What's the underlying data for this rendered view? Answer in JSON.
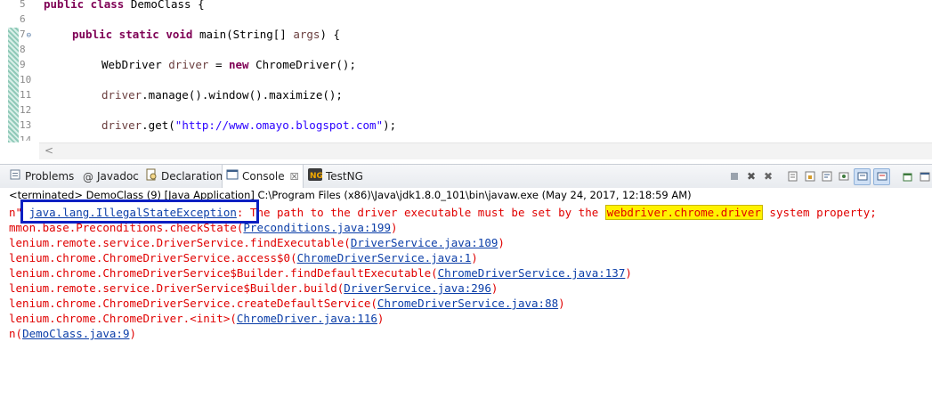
{
  "editor": {
    "lines": [
      {
        "n": "5",
        "fold": "",
        "code": [
          {
            "t": "public class ",
            "s": "kw"
          },
          {
            "t": "DemoClass {",
            "s": ""
          }
        ],
        "top": 0
      },
      {
        "n": "6",
        "fold": "",
        "code": [],
        "top": 0
      },
      {
        "n": "7",
        "fold": "⊖",
        "code": [],
        "top": 0
      },
      {
        "n": "8",
        "fold": "",
        "code": [],
        "top": 0
      },
      {
        "n": "9",
        "fold": "",
        "code": [],
        "top": 0
      },
      {
        "n": "10",
        "fold": "",
        "code": [],
        "top": 0
      },
      {
        "n": "11",
        "fold": "",
        "code": [],
        "top": 0
      },
      {
        "n": "12",
        "fold": "",
        "code": [],
        "top": 0
      },
      {
        "n": "13",
        "fold": "",
        "code": [],
        "top": 0
      },
      {
        "n": "14",
        "fold": "",
        "code": [],
        "top": 0
      }
    ],
    "code_line_5_a": "public class",
    "code_line_5_b": " DemoClass {",
    "code_line_7_a": "public static void",
    "code_line_7_b": " main(String[] ",
    "code_line_7_c": "args",
    "code_line_7_d": ") {",
    "code_line_9_a": "WebDriver ",
    "code_line_9_b": "driver",
    "code_line_9_c": " = ",
    "code_line_9_d": "new",
    "code_line_9_e": " ChromeDriver();",
    "code_line_11_a": "driver",
    "code_line_11_b": ".manage().window().maximize();",
    "code_line_13_a": "driver",
    "code_line_13_b": ".get(",
    "code_line_13_c": "\"http://www.omayo.blogspot.com\"",
    "code_line_13_d": ");",
    "scroll_left": "<"
  },
  "tabs": {
    "problems": "Problems",
    "javadoc": "Javadoc",
    "declaration": "Declaration",
    "console": "Console",
    "console_close": "☒",
    "testng": "TestNG"
  },
  "console": {
    "terminated": "<terminated> DemoClass (9) [Java Application] C:\\Program Files (x86)\\Java\\jdk1.8.0_101\\bin\\javaw.exe (May 24, 2017, 12:18:59 AM)",
    "l1_prefix": "n\" ",
    "l1_link": "java.lang.IllegalStateException",
    "l1_mid": ": The path to the driver executable must be set by the ",
    "l1_hl": "webdriver.chrome.driver",
    "l1_suffix": " system property;",
    "l2_text": "mmon.base.Preconditions.checkState(",
    "l2_link": "Preconditions.java:199",
    "l3_text": "lenium.remote.service.DriverService.findExecutable(",
    "l3_link": "DriverService.java:109",
    "l4_text": "lenium.chrome.ChromeDriverService.access$0(",
    "l4_link": "ChromeDriverService.java:1",
    "l5_text": "lenium.chrome.ChromeDriverService$Builder.findDefaultExecutable(",
    "l5_link": "ChromeDriverService.java:137",
    "l6_text": "lenium.remote.service.DriverService$Builder.build(",
    "l6_link": "DriverService.java:296",
    "l7_text": "lenium.chrome.ChromeDriverService.createDefaultService(",
    "l7_link": "ChromeDriverService.java:88",
    "l8_text": "lenium.chrome.ChromeDriver.<init>(",
    "l8_link": "ChromeDriver.java:116",
    "l9_text": "n(",
    "l9_link": "DemoClass.java:9",
    "close_paren": ")"
  },
  "colors": {
    "error_text": "#e00000",
    "link": "#0b3ea8",
    "highlight": "#fff200",
    "annotation_box": "#0a1fc2",
    "keyword": "#7f0055",
    "string": "#2a00ff"
  }
}
